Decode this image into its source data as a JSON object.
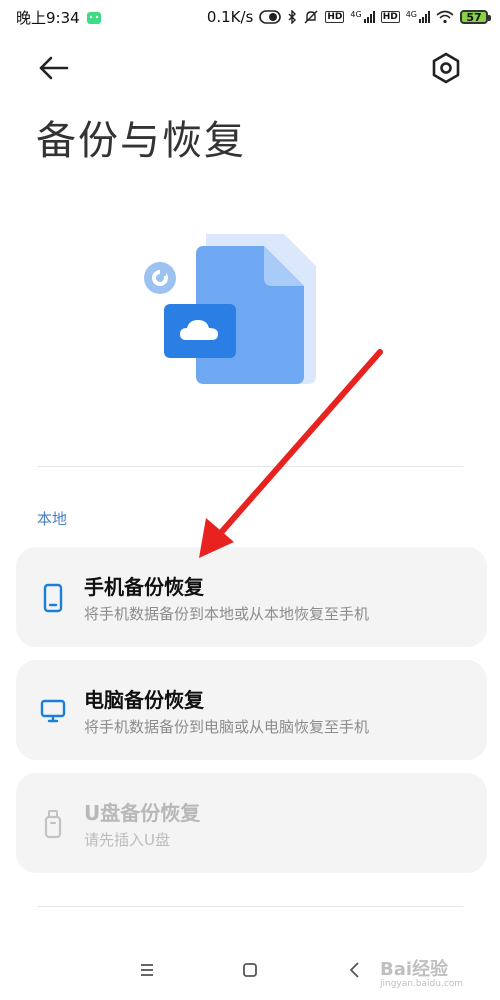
{
  "status_bar": {
    "time": "晚上9:34",
    "net_speed": "0.1K/s",
    "network_label_1": "4G",
    "network_label_2": "4G",
    "hd_label": "HD",
    "battery_level": "57"
  },
  "header": {
    "title": "备份与恢复"
  },
  "section": {
    "label": "本地"
  },
  "options": [
    {
      "title": "手机备份恢复",
      "subtitle": "将手机数据备份到本地或从本地恢复至手机",
      "icon": "phone-icon",
      "enabled": true
    },
    {
      "title": "电脑备份恢复",
      "subtitle": "将手机数据备份到电脑或从电脑恢复至手机",
      "icon": "monitor-icon",
      "enabled": true
    },
    {
      "title": "U盘备份恢复",
      "subtitle": "请先插入U盘",
      "icon": "usb-drive-icon",
      "enabled": false
    }
  ],
  "watermark": {
    "text": "Bai经验",
    "sub": "jingyan.baidu.com"
  },
  "colors": {
    "accent": "#1a7fd9",
    "card_bg": "#f4f4f4",
    "annotation_arrow": "#e8231f"
  }
}
